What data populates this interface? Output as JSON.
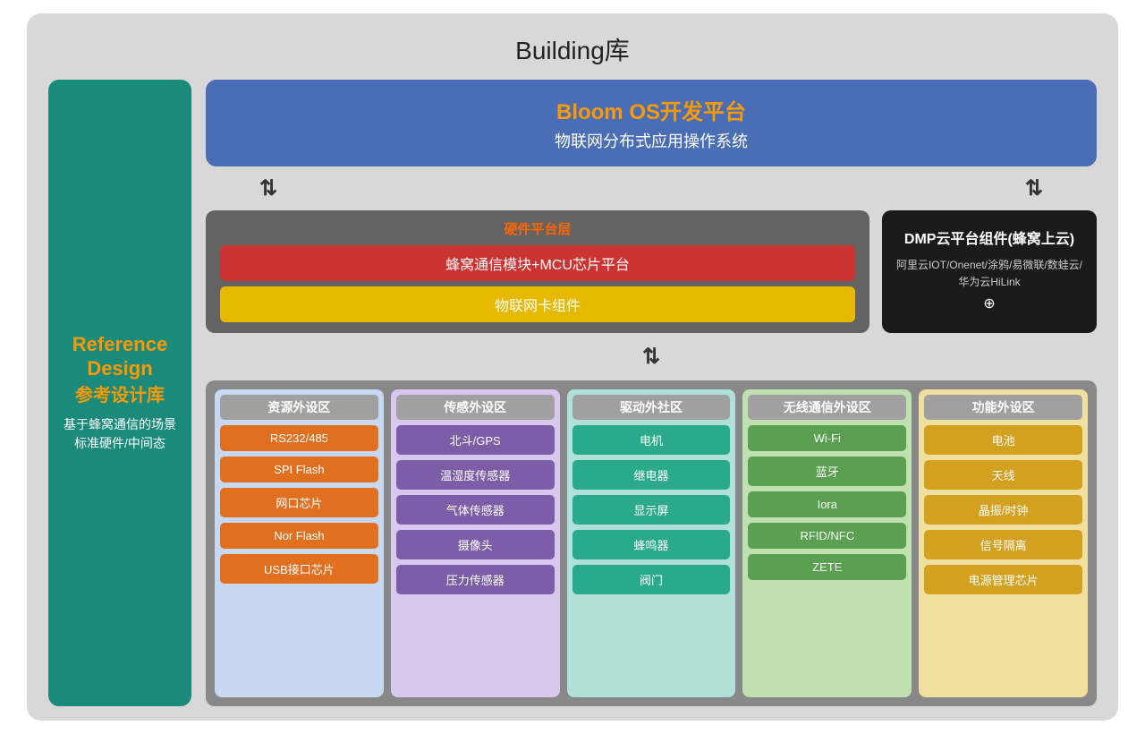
{
  "page": {
    "title": "Building库"
  },
  "bloom_os": {
    "title": "Bloom OS开发平台",
    "subtitle": "物联网分布式应用操作系统"
  },
  "hardware": {
    "section_title": "硬件平台层",
    "row1": "蜂窝通信模块+MCU芯片平台",
    "row2": "物联网卡组件"
  },
  "dmp": {
    "title": "DMP云平台组件(蜂窝上云)",
    "desc": "阿里云IOT/Onenet/涂鸦/易微联/数蛙云/华为云HiLink",
    "plus": "⊕"
  },
  "left_sidebar": {
    "title_line1": "Reference",
    "title_line2": "Design",
    "subtitle": "参考设计库",
    "desc": "基于蜂窝通信的场景标准硬件/中间态"
  },
  "grid": {
    "columns": [
      {
        "id": "resource",
        "header": "资源外设区",
        "items": [
          "RS232/485",
          "SPI Flash",
          "网口芯片",
          "Nor Flash",
          "USB接口芯片"
        ]
      },
      {
        "id": "sensor",
        "header": "传感外设区",
        "items": [
          "北斗/GPS",
          "温湿度传感器",
          "气体传感器",
          "摄像头",
          "压力传感器"
        ]
      },
      {
        "id": "driver",
        "header": "驱动外社区",
        "items": [
          "电机",
          "继电器",
          "显示屏",
          "蜂鸣器",
          "阀门"
        ]
      },
      {
        "id": "wireless",
        "header": "无线通信外设区",
        "items": [
          "Wi-Fi",
          "蓝牙",
          "Iora",
          "RFID/NFC",
          "ZETE"
        ]
      },
      {
        "id": "function",
        "header": "功能外设区",
        "items": [
          "电池",
          "天线",
          "晶振/时钟",
          "信号隔离",
          "电源管理芯片"
        ]
      }
    ]
  }
}
